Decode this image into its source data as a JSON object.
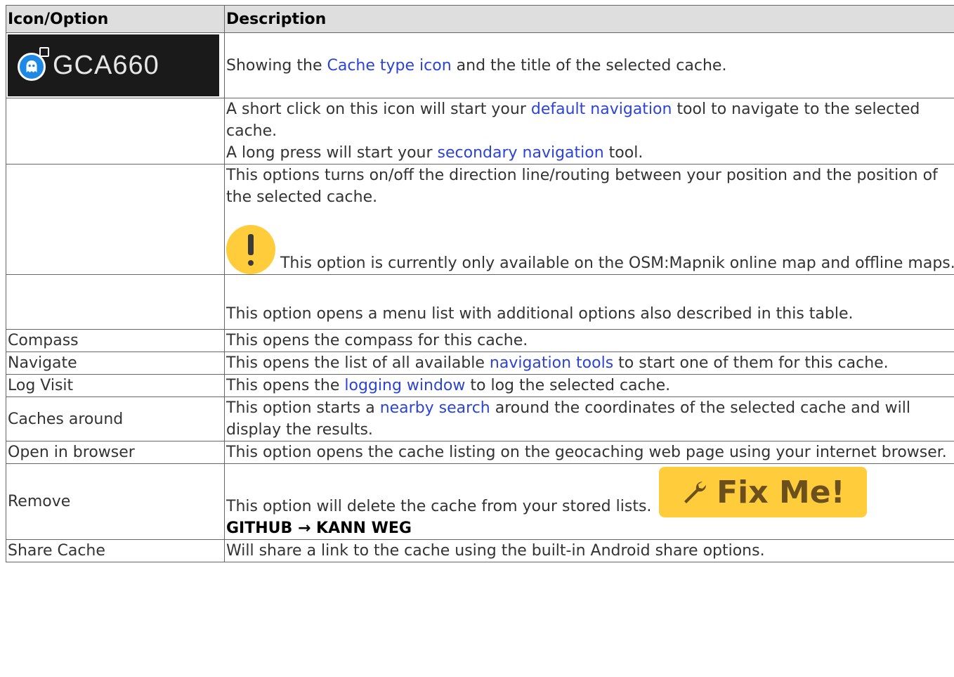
{
  "table": {
    "header": {
      "col1": "Icon/Option",
      "col2": "Description"
    },
    "row1": {
      "badge_text": "GCA660",
      "desc_pre": "Showing the ",
      "desc_link": "Cache type icon",
      "desc_post": " and the title of the selected cache."
    },
    "row2": {
      "line1_pre": "A short click on this icon will start your ",
      "line1_link": "default navigation",
      "line1_post": " tool to navigate to the selected cache.",
      "line2_pre": "A long press will start your ",
      "line2_link": "secondary navigation",
      "line2_post": " tool."
    },
    "row3": {
      "desc": "This options turns on/off the direction line/routing between your position and the position of the selected cache.",
      "note": " This option is currently only available on the OSM:Mapnik online map and offline maps."
    },
    "row4": {
      "desc": "This option opens a menu list with additional options also described in this table."
    },
    "row5": {
      "option": "Compass",
      "desc": "This opens the compass for this cache."
    },
    "row6": {
      "option": "Navigate",
      "desc_pre": "This opens the list of all available ",
      "desc_link": "navigation tools",
      "desc_post": " to start one of them for this cache."
    },
    "row7": {
      "option": "Log Visit",
      "desc_pre": "This opens the ",
      "desc_link": "logging window",
      "desc_post": " to log the selected cache."
    },
    "row8": {
      "option": "Caches around",
      "desc_pre": "This option starts a ",
      "desc_link": "nearby search",
      "desc_post": " around the coordinates of the selected cache and will display the results."
    },
    "row9": {
      "option": "Open in browser",
      "desc": "This option opens the cache listing on the geocaching web page using your internet browser."
    },
    "row10": {
      "option": "Remove",
      "desc": "This option will delete the cache from your stored lists. ",
      "fixme": "Fix Me!",
      "note": "GITHUB → KANN WEG"
    },
    "row11": {
      "option": "Share Cache",
      "desc": "Will share a link to the cache using the built-in Android share options."
    }
  },
  "colors": {
    "link": "#2b43d6",
    "header_bg": "#dedede",
    "warning": "#ffcd3c",
    "badge_bg": "#1a1a1a",
    "cache_icon": "#1e88e5"
  },
  "icons": {
    "cache_type": "ghost-icon",
    "warning": "exclamation-icon",
    "fixme": "wrench-icon"
  }
}
